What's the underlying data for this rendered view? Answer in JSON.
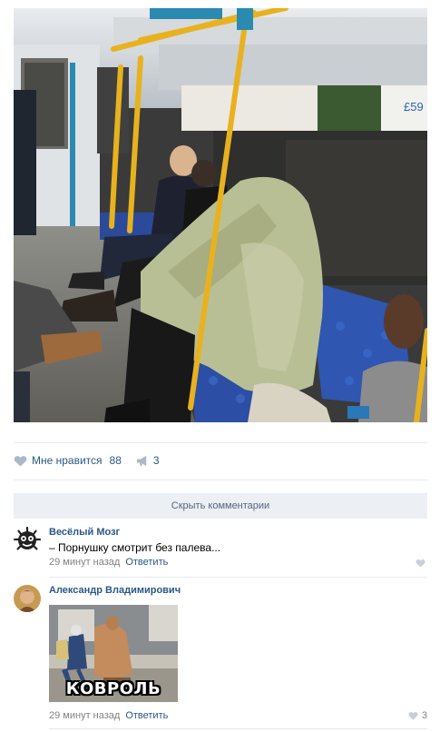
{
  "post": {
    "likes_label": "Мне нравится",
    "likes_count": "88",
    "shares_count": "3"
  },
  "comments_toggle": "Скрыть комментарии",
  "comments": [
    {
      "author": "Весёлый Мозг",
      "text": "– Порнушку смотрит без палева...",
      "time": "29 минут назад",
      "reply": "Ответить"
    },
    {
      "author": "Александр Владимирович",
      "meme_caption": "КОВРОЛЬ",
      "time": "29 минут назад",
      "reply": "Ответить",
      "likes": "3"
    }
  ],
  "ad_text": "£59",
  "colors": {
    "link": "#2a5885",
    "meta": "#828282",
    "button_bg": "#eceff3",
    "divider": "#e7e8ec",
    "pole": "#e8b21e"
  }
}
